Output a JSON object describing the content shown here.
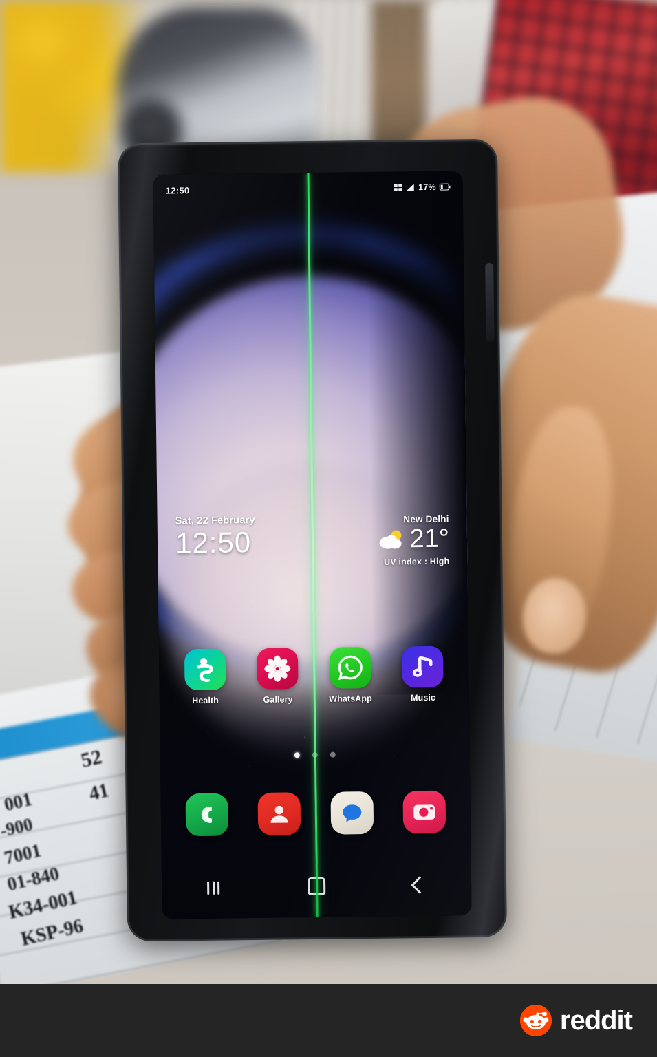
{
  "scene": {
    "description": "Hand holding a Samsung Galaxy smartphone with a green vertical display defect line, outdoors over handwritten ledger papers"
  },
  "phone": {
    "status_bar": {
      "time": "12:50",
      "battery_percent": "17%",
      "icons": [
        "network-icon",
        "signal-bars-icon",
        "battery-icon"
      ]
    },
    "clock_widget": {
      "date": "Sat, 22 February",
      "time": "12:50"
    },
    "weather_widget": {
      "city": "New Delhi",
      "temperature": "21°",
      "uv_index": "UV index : High",
      "condition_icon": "partly-cloudy-icon"
    },
    "apps": [
      {
        "label": "Health",
        "icon": "health-icon",
        "color": "#0ad2a0"
      },
      {
        "label": "Gallery",
        "icon": "gallery-icon",
        "color": "#ee1b5d"
      },
      {
        "label": "WhatsApp",
        "icon": "whatsapp-icon",
        "color": "#23c723"
      },
      {
        "label": "Music",
        "icon": "music-icon",
        "color": "#5127e0"
      }
    ],
    "page_dots": {
      "count": 3,
      "active_index": 0
    },
    "dock": [
      {
        "label": "Phone",
        "icon": "phone-icon",
        "color": "#14a848"
      },
      {
        "label": "Contacts",
        "icon": "contacts-icon",
        "color": "#df2a22"
      },
      {
        "label": "Messages",
        "icon": "messages-icon",
        "color": "#e8e2d6"
      },
      {
        "label": "Camera",
        "icon": "camera-icon",
        "color": "#e51f52"
      }
    ],
    "nav_bar": [
      {
        "label": "Recents",
        "icon": "recents-icon"
      },
      {
        "label": "Home",
        "icon": "home-icon"
      },
      {
        "label": "Back",
        "icon": "back-icon"
      }
    ],
    "defect": {
      "type": "green-vertical-line",
      "color": "#4ff27a"
    }
  },
  "watermark": {
    "label": "reddit",
    "icon": "reddit-snoo-icon",
    "color": "#ff4500"
  },
  "background_notes": {
    "ledger_scribbles": [
      "52",
      "41",
      "001",
      "-900",
      "7001",
      "01-840",
      "K34-001",
      "KSP-96"
    ]
  }
}
